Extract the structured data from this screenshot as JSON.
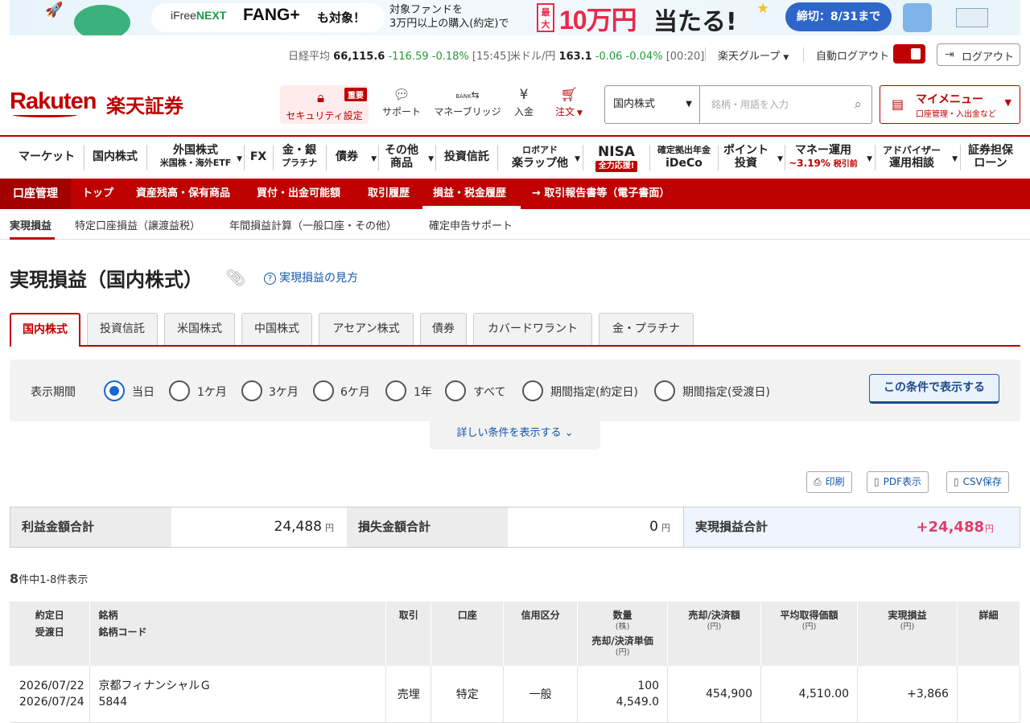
{
  "banner": {
    "ifree_prefix": "iFree",
    "ifree_next": "NEXT",
    "fang": "FANG+",
    "mo_taisho": "も対象！",
    "target_line1": "対象ファンドを",
    "target_line2": "3万円以上の購入(約定)で",
    "saidai": "最大",
    "amount": "10万円",
    "ataru": "当たる!",
    "deadline": "締切：8/31まで"
  },
  "market": {
    "nikkei_label": "日経平均",
    "nikkei_value": "66,115.6",
    "nikkei_change": "-116.59",
    "nikkei_pct": "-0.18%",
    "nikkei_time": "[15:45]",
    "usdjpy_label": "米ドル/円",
    "usdjpy_value": "163.1",
    "usdjpy_change": "-0.06",
    "usdjpy_pct": "-0.04%",
    "usdjpy_time": "[00:20]",
    "group_label": "楽天グループ",
    "autologout_label": "自動ログアウト",
    "logout_label": "ログアウト"
  },
  "header": {
    "logo_rakuten": "Rakuten",
    "logo_sec": "楽天証券",
    "security_label": "セキュリティ設定",
    "security_badge": "重要",
    "support_label": "サポート",
    "moneybridge_label": "マネーブリッジ",
    "moneybridge_bank": "BANK",
    "deposit_label": "入金",
    "order_label": "注文",
    "search_select": "国内株式",
    "search_placeholder": "銘柄・用語を入力",
    "mymenu_title": "マイメニュー",
    "mymenu_sub": "口座管理・入出金など"
  },
  "gnav": {
    "market": "マーケット",
    "domestic": "国内株式",
    "foreign1": "外国株式",
    "foreign2": "米国株・海外ETF",
    "fx": "FX",
    "gold1": "金・銀",
    "gold2": "プラチナ",
    "bond": "債券",
    "other1": "その他",
    "other2": "商品",
    "fund": "投資信託",
    "robo1": "ロボアド",
    "robo2": "楽ラップ他",
    "nisa1": "NISA",
    "nisa2": "全力応援!",
    "ideco1": "確定拠出年金",
    "ideco2": "iDeCo",
    "point1": "ポイント",
    "point2": "投資",
    "money1": "マネー運用",
    "money2_rate": "~3.19%",
    "money2_note": "税引前",
    "adv1": "アドバイザー",
    "adv2": "運用相談",
    "secloan1": "証券担保",
    "secloan2": "ローン"
  },
  "acctbar": {
    "title": "口座管理",
    "items": [
      "トップ",
      "資産残高・保有商品",
      "買付・出金可能額",
      "取引履歴",
      "損益・税金履歴",
      "→ 取引報告書等（電子書面）"
    ]
  },
  "subtabs": [
    "実現損益",
    "特定口座損益（譲渡益税）",
    "年間損益計算（一般口座・その他）",
    "確定申告サポート"
  ],
  "page": {
    "title": "実現損益（国内株式）",
    "help": "実現損益の見方"
  },
  "product_tabs": [
    "国内株式",
    "投資信託",
    "米国株式",
    "中国株式",
    "アセアン株式",
    "債券",
    "カバードワラント",
    "金・プラチナ"
  ],
  "filter": {
    "label": "表示期間",
    "options": [
      "当日",
      "1ケ月",
      "3ケ月",
      "6ケ月",
      "1年",
      "すべて",
      "期間指定(約定日)",
      "期間指定(受渡日)"
    ],
    "selected": "当日",
    "show_button": "この条件で表示する",
    "detail_toggle": "詳しい条件を表示する"
  },
  "export": {
    "print": "印刷",
    "pdf": "PDF表示",
    "csv": "CSV保存"
  },
  "totals": {
    "profit_label": "利益金額合計",
    "profit_value": "24,488",
    "loss_label": "損失金額合計",
    "loss_value": "0",
    "net_label": "実現損益合計",
    "net_value": "+24,488",
    "yen": "円"
  },
  "count": {
    "total": "8",
    "text": "件中1-8件表示"
  },
  "table": {
    "headers": {
      "date1": "約定日",
      "date2": "受渡日",
      "name1": "銘柄",
      "name2": "銘柄コード",
      "trade": "取引",
      "account": "口座",
      "margin": "信用区分",
      "qty1": "数量",
      "qty_unit": "(株)",
      "qty2": "売却/決済単価",
      "qty2_unit": "(円)",
      "amount": "売却/決済額",
      "amount_unit": "(円)",
      "avg": "平均取得価額",
      "avg_unit": "(円)",
      "pl": "実現損益",
      "pl_unit": "(円)",
      "detail": "詳細"
    },
    "rows": [
      {
        "trade_date": "2026/07/22",
        "settle_date": "2026/07/24",
        "name": "京都フィナンシャルＧ",
        "code": "5844",
        "trade": "売埋",
        "account": "特定",
        "margin": "一般",
        "qty": "100",
        "price": "4,549.0",
        "amount": "454,900",
        "avg": "4,510.00",
        "pl": "+3,866"
      }
    ]
  }
}
